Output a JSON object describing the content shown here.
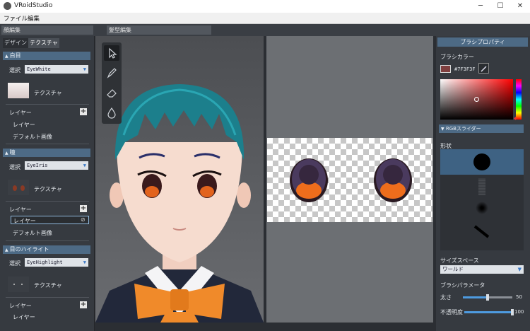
{
  "window": {
    "title": "VRoidStudio",
    "minimize": "─",
    "maximize": "☐",
    "close": "✕"
  },
  "menu": {
    "file": "ファイル",
    "edit": "編集"
  },
  "top_tabs": {
    "face_edit": "顔編集",
    "hair_edit": "髪型編集"
  },
  "left_panel": {
    "tabs": {
      "design": "デザイン",
      "texture": "テクスチャ"
    },
    "sections": [
      {
        "title": "白目",
        "select_label": "選択",
        "select_value": "EyeWhite",
        "texture_label": "テクスチャ",
        "layer_header": "レイヤー",
        "layers": [
          "レイヤー",
          "デフォルト画像"
        ]
      },
      {
        "title": "瞳",
        "select_label": "選択",
        "select_value": "EyeIris",
        "texture_label": "テクスチャ",
        "layer_header": "レイヤー",
        "layers": [
          "レイヤー",
          "デフォルト画像"
        ]
      },
      {
        "title": "目のハイライト",
        "select_label": "選択",
        "select_value": "EyeHighlight",
        "texture_label": "テクスチャ",
        "layer_header": "レイヤー",
        "layers": [
          "レイヤー"
        ]
      }
    ]
  },
  "tools": [
    "cursor-icon",
    "pen-icon",
    "eraser-icon",
    "fill-icon"
  ],
  "right_panel": {
    "title": "ブラシプロパティ",
    "brush_color_label": "ブラシカラー",
    "brush_color_hex": "#7F3F3F",
    "brush_color": "#7f3f3f",
    "rgb_slider_label": "RGBスライダー",
    "shape_label": "形状",
    "size_space_label": "サイズスペース",
    "size_space_value": "ワールド",
    "brush_params_label": "ブラシパラメータ",
    "thickness_label": "太さ",
    "thickness_value": "50",
    "thickness_fraction": 0.5,
    "opacity_label": "不透明度",
    "opacity_value": "100",
    "opacity_fraction": 1.0
  }
}
